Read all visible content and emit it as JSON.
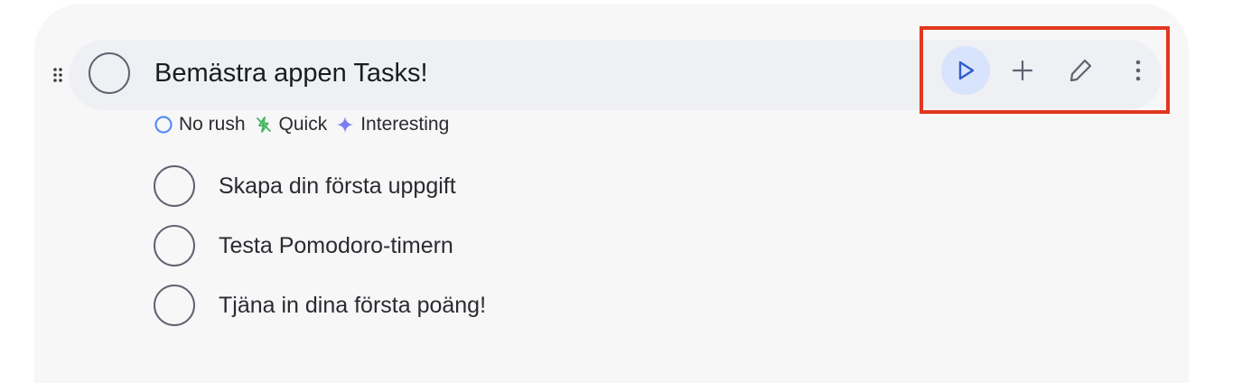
{
  "task": {
    "title": "Bemästra appen Tasks!",
    "tags": [
      {
        "label": "No rush",
        "icon": "circle-outline-icon",
        "color": "#5a8cf0"
      },
      {
        "label": "Quick",
        "icon": "lightning-off-icon",
        "color": "#3cb35a"
      },
      {
        "label": "Interesting",
        "icon": "sparkle-icon",
        "color": "#7b7ff2"
      }
    ],
    "subtasks": [
      {
        "label": "Skapa din första uppgift"
      },
      {
        "label": "Testa Pomodoro-timern"
      },
      {
        "label": "Tjäna in dina första poäng!"
      }
    ]
  },
  "actions": {
    "play": {
      "icon": "play-icon",
      "color": "#2f5ccf"
    },
    "add": {
      "icon": "plus-icon"
    },
    "edit": {
      "icon": "pencil-icon"
    },
    "more": {
      "icon": "more-vertical-icon"
    }
  },
  "colors": {
    "highlight": "#e2371f",
    "panel": "#f7f7f8",
    "row": "#eff0f4"
  }
}
